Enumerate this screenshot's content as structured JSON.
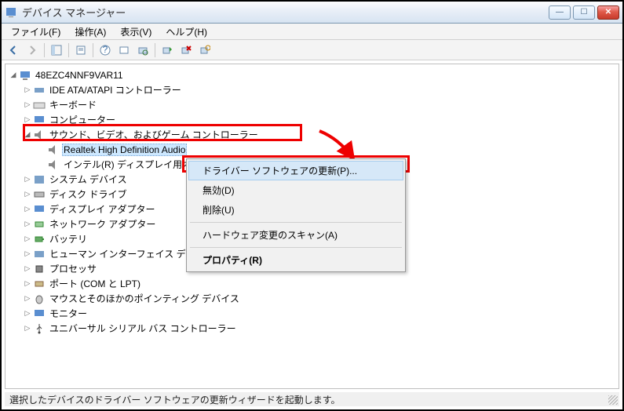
{
  "window": {
    "title": "デバイス マネージャー"
  },
  "menu": {
    "file": "ファイル(F)",
    "action": "操作(A)",
    "view": "表示(V)",
    "help": "ヘルプ(H)"
  },
  "tree": {
    "root": "48EZC4NNF9VAR11",
    "items": [
      "IDE ATA/ATAPI コントローラー",
      "キーボード",
      "コンピューター"
    ],
    "sound": {
      "label": "サウンド、ビデオ、およびゲーム コントローラー",
      "children": [
        "Realtek High Definition Audio",
        "インテル(R) ディスプレイ用オーディオ"
      ]
    },
    "rest": [
      "システム デバイス",
      "ディスク ドライブ",
      "ディスプレイ アダプター",
      "ネットワーク アダプター",
      "バッテリ",
      "ヒューマン インターフェイス デバイス",
      "プロセッサ",
      "ポート (COM と LPT)",
      "マウスとそのほかのポインティング デバイス",
      "モニター",
      "ユニバーサル シリアル バス コントローラー"
    ]
  },
  "context_menu": {
    "update": "ドライバー ソフトウェアの更新(P)...",
    "disable": "無効(D)",
    "uninstall": "削除(U)",
    "scan": "ハードウェア変更のスキャン(A)",
    "properties": "プロパティ(R)"
  },
  "status": "選択したデバイスのドライバー ソフトウェアの更新ウィザードを起動します。"
}
